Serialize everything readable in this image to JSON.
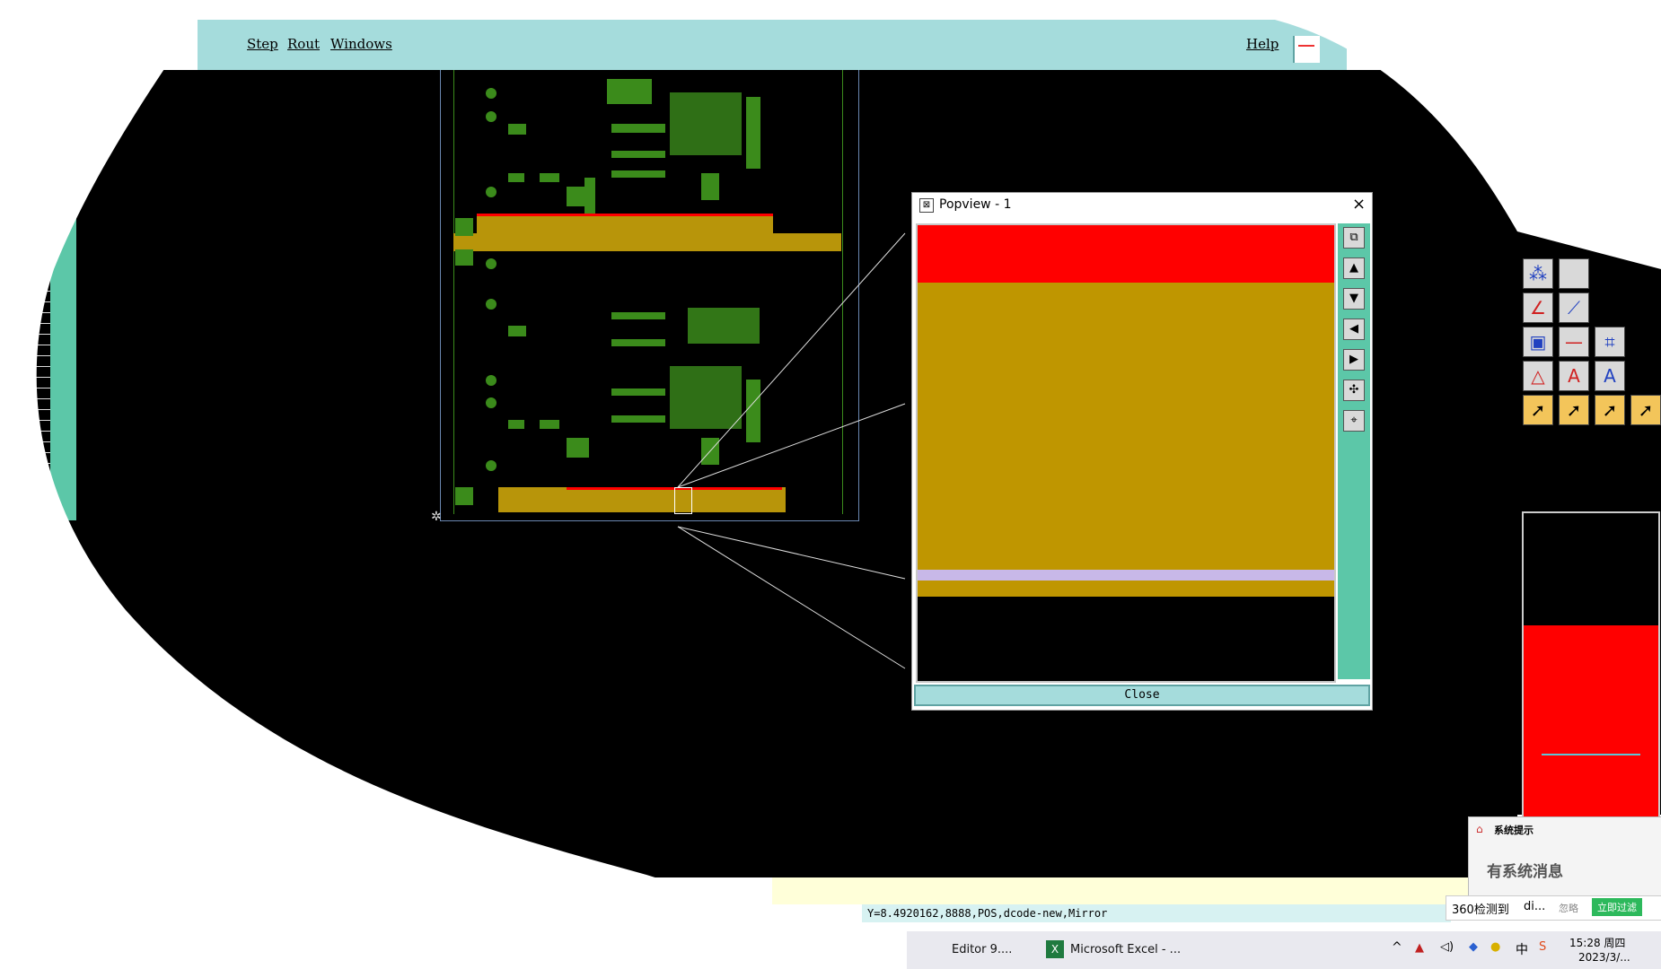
{
  "menubar": {
    "items": [
      "Step",
      "Rout",
      "Windows"
    ],
    "help": "Help"
  },
  "popview": {
    "title": "Popview - 1",
    "close_label": "Close",
    "colors": {
      "red": "#ff0000",
      "gold": "#bf9600",
      "lavender": "#c8b8e8"
    }
  },
  "status": {
    "text": "Y=8.4920162,8888,POS,dcode-new,Mirror"
  },
  "notification": {
    "title": "系统提示",
    "message": "有系统消息",
    "bar_text": "360检测到",
    "bar_text2": "di...",
    "ignore": "忽略",
    "action": "立即过滤"
  },
  "taskbar": {
    "task1": "Editor 9....",
    "task2": "Microsoft Excel - ...",
    "ime": "中",
    "time": "15:28 周四",
    "date": "2023/3/..."
  }
}
